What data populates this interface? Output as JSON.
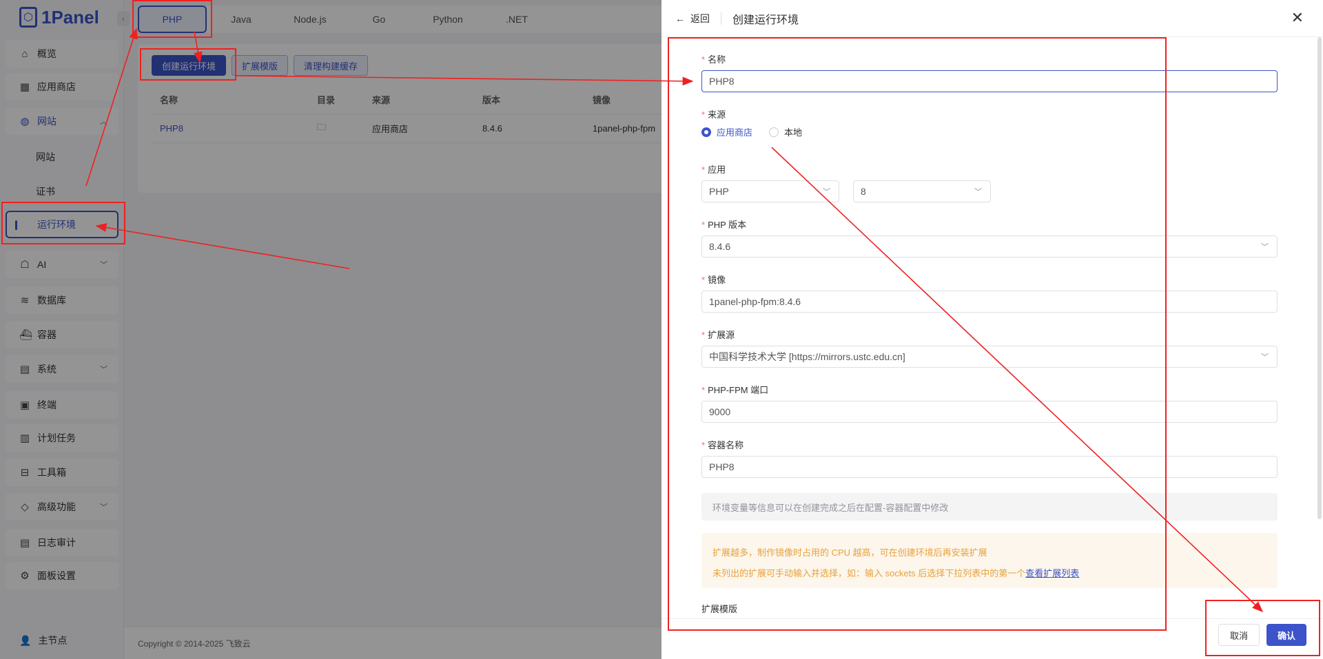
{
  "app": {
    "logo": "1Panel",
    "sidebar": {
      "items": [
        {
          "label": "概览",
          "icon": "home-icon"
        },
        {
          "label": "应用商店",
          "icon": "grid-icon"
        },
        {
          "label": "网站",
          "icon": "globe-icon"
        },
        {
          "label": "AI",
          "icon": "robot-icon"
        },
        {
          "label": "数据库",
          "icon": "database-icon"
        },
        {
          "label": "容器",
          "icon": "docker-icon"
        },
        {
          "label": "系统",
          "icon": "system-icon"
        },
        {
          "label": "终端",
          "icon": "terminal-icon"
        },
        {
          "label": "计划任务",
          "icon": "calendar-icon"
        },
        {
          "label": "工具箱",
          "icon": "toolbox-icon"
        },
        {
          "label": "高级功能",
          "icon": "diamond-icon"
        },
        {
          "label": "日志审计",
          "icon": "log-icon"
        },
        {
          "label": "面板设置",
          "icon": "gear-icon"
        }
      ],
      "website_sub": [
        "网站",
        "证书",
        "运行环境"
      ],
      "user": "主节点"
    },
    "tabs": [
      "PHP",
      "Java",
      "Node.js",
      "Go",
      "Python",
      ".NET"
    ],
    "buttons": {
      "create": "创建运行环境",
      "ext_template": "扩展模版",
      "clear_cache": "清理构建缓存"
    },
    "table": {
      "headers": [
        "名称",
        "目录",
        "来源",
        "版本",
        "镜像"
      ],
      "rows": [
        {
          "name": "PHP8",
          "source": "应用商店",
          "version": "8.4.6",
          "image": "1panel-php-fpm"
        }
      ]
    },
    "footer": "Copyright © 2014-2025 飞致云"
  },
  "drawer": {
    "back": "返回",
    "title": "创建运行环境",
    "name": {
      "label": "名称",
      "value": "PHP8"
    },
    "source": {
      "label": "来源",
      "options": [
        "应用商店",
        "本地"
      ],
      "selected": "应用商店"
    },
    "app": {
      "label": "应用",
      "app_value": "PHP",
      "version_value": "8"
    },
    "php_version": {
      "label": "PHP 版本",
      "value": "8.4.6"
    },
    "image": {
      "label": "镜像",
      "value": "1panel-php-fpm:8.4.6"
    },
    "ext_source": {
      "label": "扩展源",
      "value": "中国科学技术大学 [https://mirrors.ustc.edu.cn]"
    },
    "fpm_port": {
      "label": "PHP-FPM 端口",
      "value": "9000"
    },
    "container_name": {
      "label": "容器名称",
      "value": "PHP8"
    },
    "info": "环境变量等信息可以在创建完成之后在配置-容器配置中修改",
    "warn_line1": "扩展越多，制作镜像时占用的 CPU 越高，可在创建环境后再安装扩展",
    "warn_line2": "未列出的扩展可手动输入并选择，如：输入 sockets 后选择下拉列表中的第一个",
    "warn_link": "查看扩展列表",
    "ext_template_label": "扩展模版",
    "cancel": "取消",
    "confirm": "确认"
  }
}
